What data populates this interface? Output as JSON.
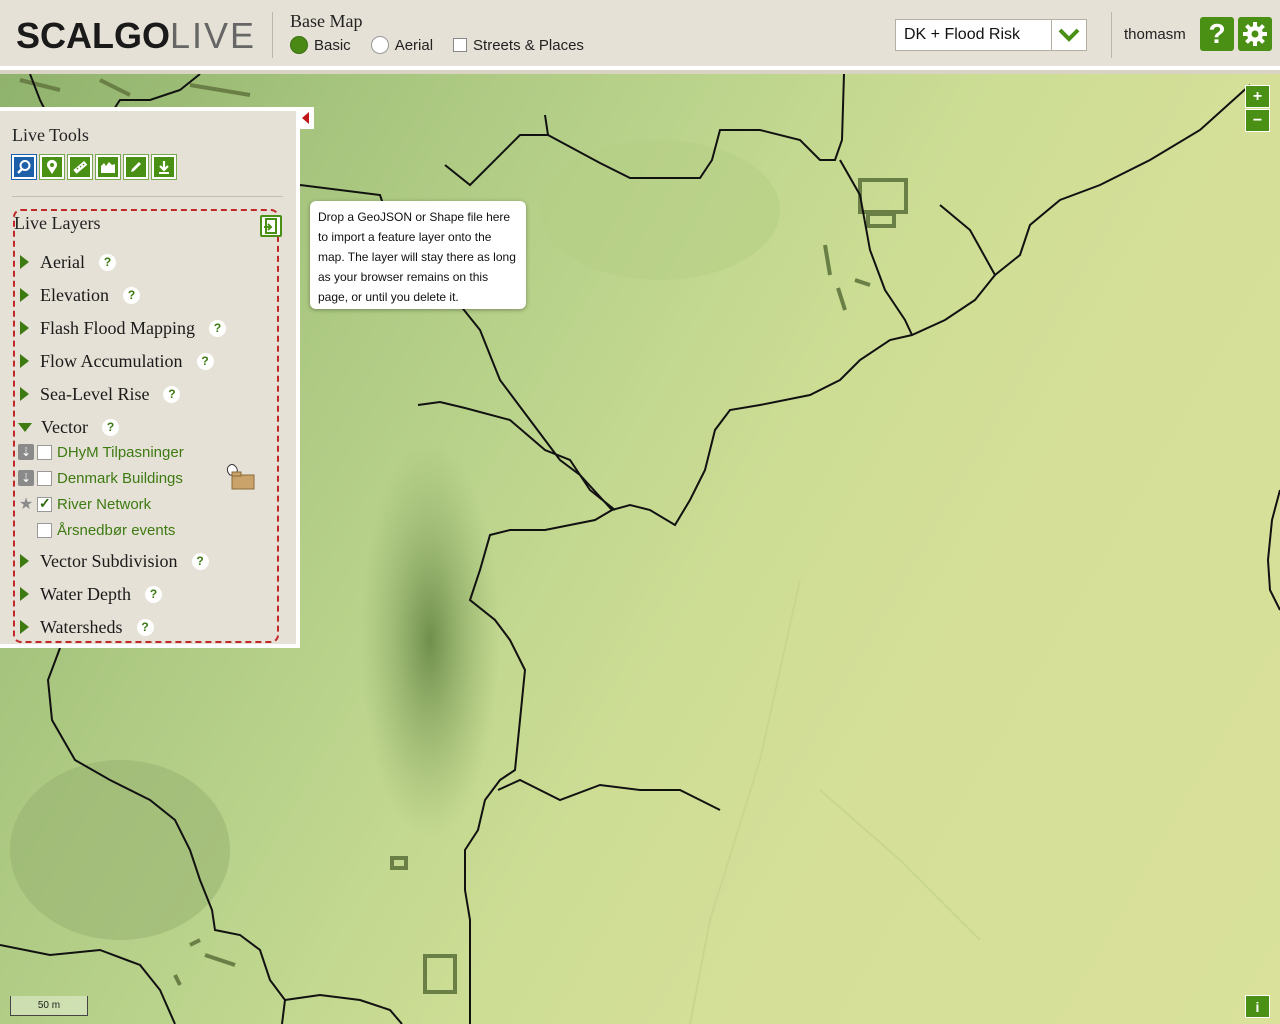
{
  "header": {
    "logo_part1": "SCALG",
    "logo_part2": "O",
    "logo_part3": "LIVE",
    "basemap_title": "Base Map",
    "basemap_options": [
      {
        "label": "Basic",
        "selected": true
      },
      {
        "label": "Aerial",
        "selected": false
      }
    ],
    "streets_label": "Streets & Places",
    "streets_checked": false,
    "scenario_value": "DK + Flood Risk",
    "username": "thomasm",
    "help_label": "?",
    "accent_color": "#4a9014"
  },
  "tools": {
    "title": "Live Tools",
    "items": [
      "search-icon",
      "location-pin-icon",
      "ruler-icon",
      "terrain-icon",
      "pencil-icon",
      "download-icon"
    ]
  },
  "layers": {
    "title": "Live Layers",
    "groups": [
      {
        "label": "Aerial",
        "expanded": false
      },
      {
        "label": "Elevation",
        "expanded": false
      },
      {
        "label": "Flash Flood Mapping",
        "expanded": false
      },
      {
        "label": "Flow Accumulation",
        "expanded": false
      },
      {
        "label": "Sea-Level Rise",
        "expanded": false
      },
      {
        "label": "Vector",
        "expanded": true
      },
      {
        "label": "Vector Subdivision",
        "expanded": false
      },
      {
        "label": "Water Depth",
        "expanded": false
      },
      {
        "label": "Watersheds",
        "expanded": false
      }
    ],
    "vector_sublayers": [
      {
        "label": "DHyM Tilpasninger",
        "checked": false,
        "icon": "download-icon"
      },
      {
        "label": "Denmark Buildings",
        "checked": false,
        "icon": "download-icon"
      },
      {
        "label": "River Network",
        "checked": true,
        "icon": "star-icon"
      },
      {
        "label": "Årsnedbør events",
        "checked": false,
        "icon": "none"
      }
    ],
    "help_mark": "?"
  },
  "tooltip": {
    "text": "Drop a GeoJSON or Shape file here to import a feature layer onto the map. The layer will stay there as long as your browser remains on this page, or until you delete it."
  },
  "map": {
    "zoom_in": "+",
    "zoom_out": "−",
    "scale_label": "50 m",
    "info_label": "i"
  }
}
